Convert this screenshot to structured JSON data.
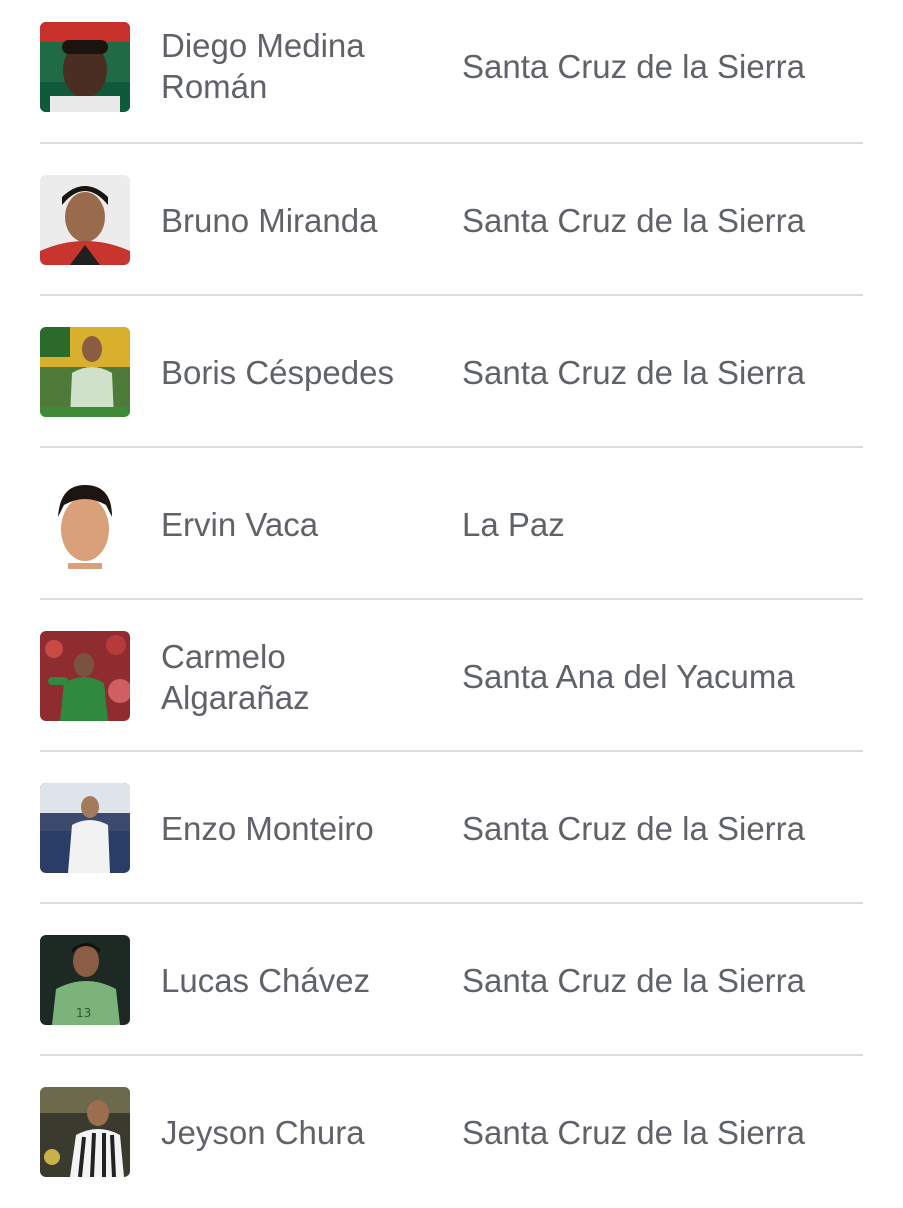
{
  "players": [
    {
      "name": "Diego Medina Román",
      "birthplace": "Santa Cruz de la Sierra",
      "avatar_icon": "player-photo-icon"
    },
    {
      "name": "Bruno Miranda",
      "birthplace": "Santa Cruz de la Sierra",
      "avatar_icon": "player-photo-icon"
    },
    {
      "name": "Boris Céspedes",
      "birthplace": "Santa Cruz de la Sierra",
      "avatar_icon": "player-photo-icon"
    },
    {
      "name": "Ervin Vaca",
      "birthplace": "La Paz",
      "avatar_icon": "player-photo-icon"
    },
    {
      "name": "Carmelo Algarañaz",
      "birthplace": "Santa Ana del Yacuma",
      "avatar_icon": "player-photo-icon"
    },
    {
      "name": "Enzo Monteiro",
      "birthplace": "Santa Cruz de la Sierra",
      "avatar_icon": "player-photo-icon"
    },
    {
      "name": "Lucas Chávez",
      "birthplace": "Santa Cruz de la Sierra",
      "avatar_icon": "player-photo-icon"
    },
    {
      "name": "Jeyson Chura",
      "birthplace": "Santa Cruz de la Sierra",
      "avatar_icon": "player-photo-icon"
    }
  ],
  "colors": {
    "text": "#5f6368",
    "divider": "#dadce0",
    "background": "#ffffff"
  }
}
